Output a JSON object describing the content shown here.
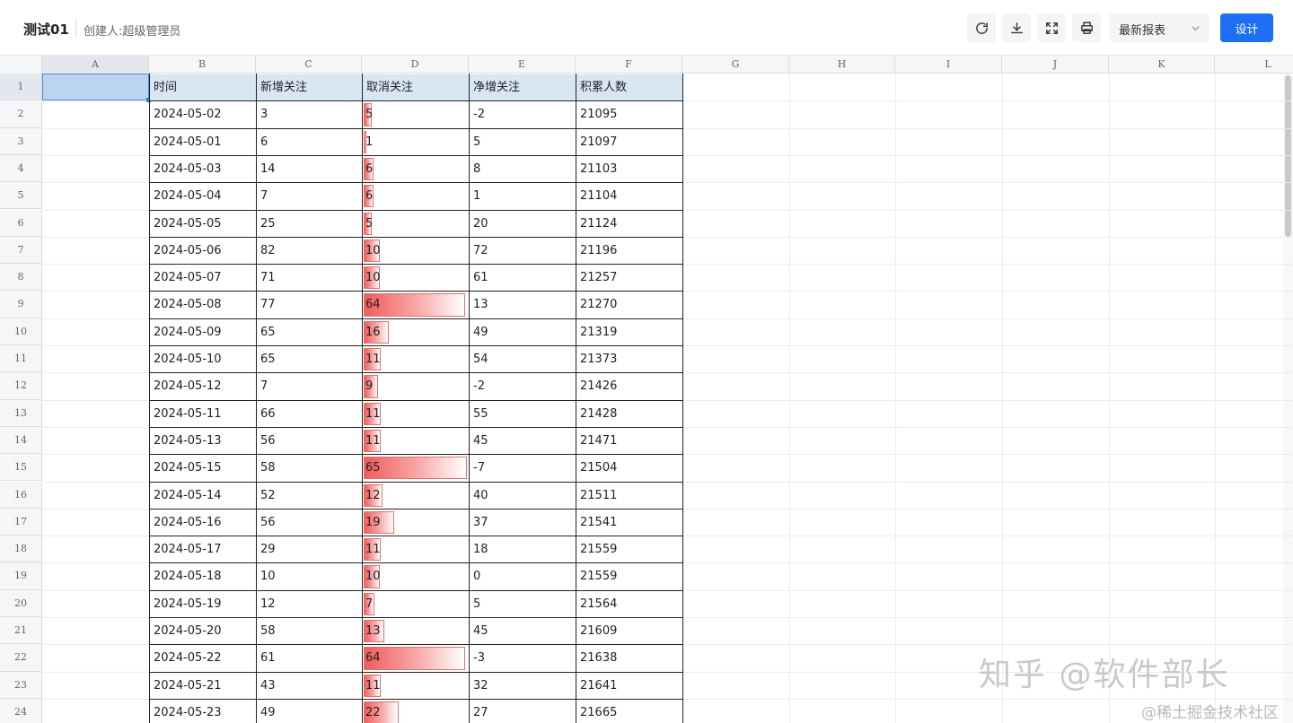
{
  "header": {
    "title": "测试01",
    "creator": "创建人:超级管理员",
    "report_select": "最新报表",
    "design_button": "设计",
    "toolbar_icons": [
      "refresh-icon",
      "download-icon",
      "fullscreen-icon",
      "print-icon"
    ]
  },
  "sheet": {
    "columns": [
      "A",
      "B",
      "C",
      "D",
      "E",
      "F",
      "G",
      "H",
      "I",
      "J",
      "K",
      "L"
    ],
    "table_headers": [
      "时间",
      "新增关注",
      "取消关注",
      "净增关注",
      "积累人数"
    ],
    "rows": [
      {
        "date": "2024-05-02",
        "new": "3",
        "cancel": "5",
        "net": "-2",
        "total": "21095"
      },
      {
        "date": "2024-05-01",
        "new": "6",
        "cancel": "1",
        "net": "5",
        "total": "21097"
      },
      {
        "date": "2024-05-03",
        "new": "14",
        "cancel": "6",
        "net": "8",
        "total": "21103"
      },
      {
        "date": "2024-05-04",
        "new": "7",
        "cancel": "6",
        "net": "1",
        "total": "21104"
      },
      {
        "date": "2024-05-05",
        "new": "25",
        "cancel": "5",
        "net": "20",
        "total": "21124"
      },
      {
        "date": "2024-05-06",
        "new": "82",
        "cancel": "10",
        "net": "72",
        "total": "21196"
      },
      {
        "date": "2024-05-07",
        "new": "71",
        "cancel": "10",
        "net": "61",
        "total": "21257"
      },
      {
        "date": "2024-05-08",
        "new": "77",
        "cancel": "64",
        "net": "13",
        "total": "21270"
      },
      {
        "date": "2024-05-09",
        "new": "65",
        "cancel": "16",
        "net": "49",
        "total": "21319"
      },
      {
        "date": "2024-05-10",
        "new": "65",
        "cancel": "11",
        "net": "54",
        "total": "21373"
      },
      {
        "date": "2024-05-12",
        "new": "7",
        "cancel": "9",
        "net": "-2",
        "total": "21426"
      },
      {
        "date": "2024-05-11",
        "new": "66",
        "cancel": "11",
        "net": "55",
        "total": "21428"
      },
      {
        "date": "2024-05-13",
        "new": "56",
        "cancel": "11",
        "net": "45",
        "total": "21471"
      },
      {
        "date": "2024-05-15",
        "new": "58",
        "cancel": "65",
        "net": "-7",
        "total": "21504"
      },
      {
        "date": "2024-05-14",
        "new": "52",
        "cancel": "12",
        "net": "40",
        "total": "21511"
      },
      {
        "date": "2024-05-16",
        "new": "56",
        "cancel": "19",
        "net": "37",
        "total": "21541"
      },
      {
        "date": "2024-05-17",
        "new": "29",
        "cancel": "11",
        "net": "18",
        "total": "21559"
      },
      {
        "date": "2024-05-18",
        "new": "10",
        "cancel": "10",
        "net": "0",
        "total": "21559"
      },
      {
        "date": "2024-05-19",
        "new": "12",
        "cancel": "7",
        "net": "5",
        "total": "21564"
      },
      {
        "date": "2024-05-20",
        "new": "58",
        "cancel": "13",
        "net": "45",
        "total": "21609"
      },
      {
        "date": "2024-05-22",
        "new": "61",
        "cancel": "64",
        "net": "-3",
        "total": "21638"
      },
      {
        "date": "2024-05-21",
        "new": "43",
        "cancel": "11",
        "net": "32",
        "total": "21641"
      },
      {
        "date": "2024-05-23",
        "new": "49",
        "cancel": "22",
        "net": "27",
        "total": "21665"
      }
    ],
    "databar_max": 65,
    "databar_color": "#f25c5c"
  },
  "watermark": {
    "main": "知乎 @软件部长",
    "sub": "@稀土掘金技术社区"
  }
}
